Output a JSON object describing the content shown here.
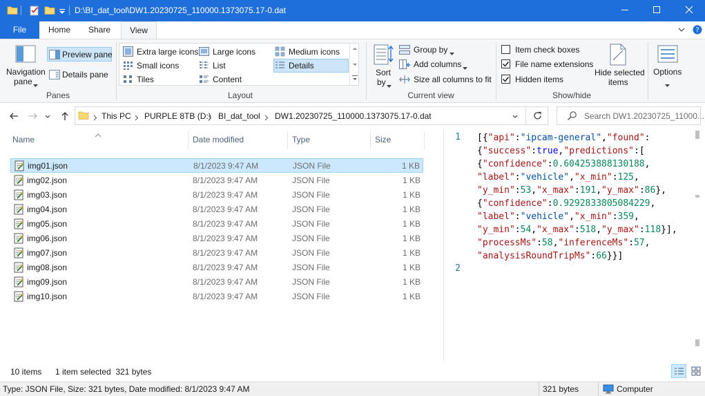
{
  "window": {
    "title": "D:\\BI_dat_tool\\DW1.20230725_110000.1373075.17-0.dat",
    "controls": {
      "minimize_icon": "minimize-icon",
      "maximize_icon": "maximize-icon",
      "close_icon": "close-icon"
    }
  },
  "ribbon_tabs": [
    "File",
    "Home",
    "Share",
    "View"
  ],
  "active_tab": "View",
  "ribbon": {
    "panes": {
      "label": "Panes",
      "navigation_pane": "Navigation pane",
      "navigation_line1": "Navigation",
      "navigation_line2": "pane",
      "preview_pane": "Preview pane",
      "details_pane": "Details pane"
    },
    "layout": {
      "label": "Layout",
      "items": [
        "Extra large icons",
        "Large icons",
        "Medium icons",
        "Small icons",
        "List",
        "Details",
        "Tiles",
        "Content"
      ],
      "selected": "Details"
    },
    "current_view": {
      "label": "Current view",
      "sort_by": "Sort by",
      "sort_line1": "Sort",
      "sort_line2": "by",
      "group_by": "Group by",
      "add_columns": "Add columns",
      "size_all_columns": "Size all columns to fit"
    },
    "show_hide": {
      "label": "Show/hide",
      "item_check_boxes": {
        "label": "Item check boxes",
        "checked": false
      },
      "file_name_extensions": {
        "label": "File name extensions",
        "checked": true
      },
      "hidden_items": {
        "label": "Hidden items",
        "checked": true
      },
      "hide_selected_line1": "Hide selected",
      "hide_selected_line2": "items"
    },
    "options": "Options"
  },
  "address": {
    "crumbs": [
      "This PC",
      "PURPLE 8TB (D:)",
      "BI_dat_tool",
      "DW1.20230725_110000.1373075.17-0.dat"
    ],
    "search_placeholder": "Search DW1.20230725_11000..."
  },
  "columns": [
    "Name",
    "Date modified",
    "Type",
    "Size"
  ],
  "files": [
    {
      "name": "img01.json",
      "date": "8/1/2023 9:47 AM",
      "type": "JSON File",
      "size": "1 KB",
      "selected": true
    },
    {
      "name": "img02.json",
      "date": "8/1/2023 9:47 AM",
      "type": "JSON File",
      "size": "1 KB"
    },
    {
      "name": "img03.json",
      "date": "8/1/2023 9:47 AM",
      "type": "JSON File",
      "size": "1 KB"
    },
    {
      "name": "img04.json",
      "date": "8/1/2023 9:47 AM",
      "type": "JSON File",
      "size": "1 KB"
    },
    {
      "name": "img05.json",
      "date": "8/1/2023 9:47 AM",
      "type": "JSON File",
      "size": "1 KB"
    },
    {
      "name": "img06.json",
      "date": "8/1/2023 9:47 AM",
      "type": "JSON File",
      "size": "1 KB"
    },
    {
      "name": "img07.json",
      "date": "8/1/2023 9:47 AM",
      "type": "JSON File",
      "size": "1 KB"
    },
    {
      "name": "img08.json",
      "date": "8/1/2023 9:47 AM",
      "type": "JSON File",
      "size": "1 KB"
    },
    {
      "name": "img09.json",
      "date": "8/1/2023 9:47 AM",
      "type": "JSON File",
      "size": "1 KB"
    },
    {
      "name": "img10.json",
      "date": "8/1/2023 9:47 AM",
      "type": "JSON File",
      "size": "1 KB"
    }
  ],
  "preview": {
    "line_numbers": [
      "1",
      "2"
    ],
    "code_lines": [
      "[{\"api\":\"ipcam-general\",\"found\":",
      "{\"success\":true,\"predictions\":[",
      "{\"confidence\":0.604253888130188,",
      "\"label\":\"vehicle\",\"x_min\":125,",
      "\"y_min\":53,\"x_max\":191,\"y_max\":86},",
      "{\"confidence\":0.9292833805084229,",
      "\"label\":\"vehicle\",\"x_min\":359,",
      "\"y_min\":54,\"x_max\":518,\"y_max\":118}],",
      "\"processMs\":58,\"inferenceMs\":57,",
      "\"analysisRoundTripMs\":66}}]"
    ]
  },
  "status": {
    "item_count": "10 items",
    "selection": "1 item selected  321 bytes",
    "bottom_info": "Type: JSON File, Size: 321 bytes, Date modified: 8/1/2023 9:47 AM",
    "bottom_size": "321 bytes",
    "bottom_location": "Computer"
  },
  "colors": {
    "title_bar": "#1e6fd9",
    "selection_fill": "#cce8ff",
    "selection_border": "#99d1ff",
    "ribbon_bg": "#f5f6f7"
  }
}
